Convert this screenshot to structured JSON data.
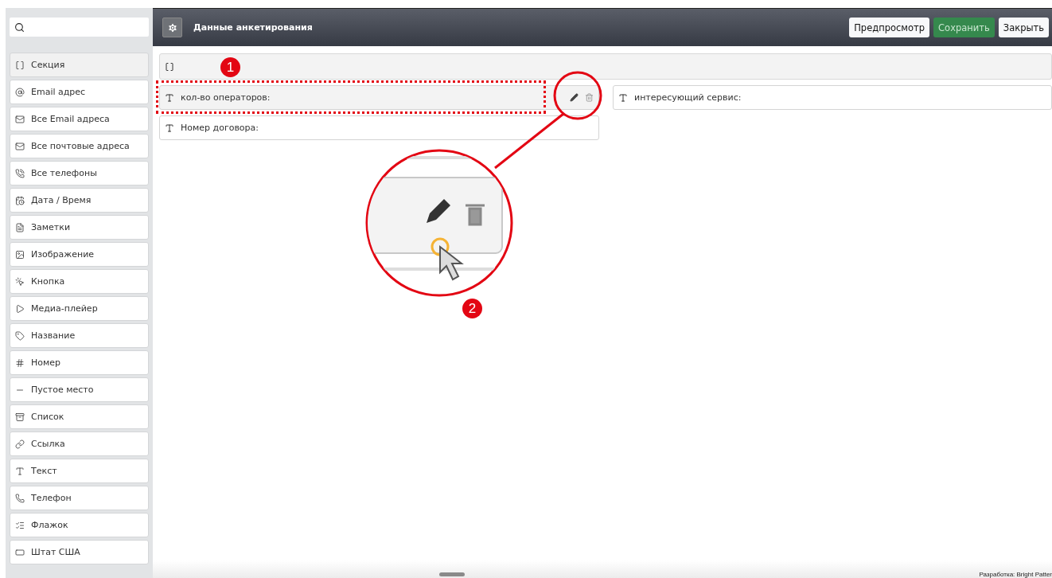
{
  "sidebar": {
    "items": [
      {
        "kind": "section",
        "label": "Секция",
        "selected": true
      },
      {
        "kind": "email",
        "label": "Email адрес",
        "selected": false
      },
      {
        "kind": "emails",
        "label": "Все Email адреса",
        "selected": false
      },
      {
        "kind": "addresses",
        "label": "Все почтовые адреса",
        "selected": false
      },
      {
        "kind": "phones",
        "label": "Все телефоны",
        "selected": false
      },
      {
        "kind": "datetime",
        "label": "Дата / Время",
        "selected": false
      },
      {
        "kind": "notes",
        "label": "Заметки",
        "selected": false
      },
      {
        "kind": "image",
        "label": "Изображение",
        "selected": false
      },
      {
        "kind": "button",
        "label": "Кнопка",
        "selected": false
      },
      {
        "kind": "media",
        "label": "Медиа-плейер",
        "selected": false
      },
      {
        "kind": "label",
        "label": "Название",
        "selected": false
      },
      {
        "kind": "number",
        "label": "Номер",
        "selected": false
      },
      {
        "kind": "spacer",
        "label": "Пустое место",
        "selected": false
      },
      {
        "kind": "list",
        "label": "Список",
        "selected": false
      },
      {
        "kind": "link",
        "label": "Ссылка",
        "selected": false
      },
      {
        "kind": "text",
        "label": "Текст",
        "selected": false
      },
      {
        "kind": "phone",
        "label": "Телефон",
        "selected": false
      },
      {
        "kind": "checkbox",
        "label": "Флажок",
        "selected": false
      },
      {
        "kind": "state",
        "label": "Штат США",
        "selected": false
      }
    ]
  },
  "header": {
    "title": "Данные анкетирования",
    "buttons": [
      {
        "label": "Предпросмотр",
        "kind": "default"
      },
      {
        "label": "Сохранить",
        "kind": "primary"
      },
      {
        "label": "Закрыть",
        "kind": "default"
      }
    ]
  },
  "form": {
    "rows": [
      [
        {
          "label": "кол-во операторов:",
          "hovered": true
        },
        {
          "label": "интересующий сервис:",
          "hovered": false
        }
      ],
      [
        {
          "label": "Номер договора:",
          "hovered": false
        }
      ]
    ]
  },
  "annotations": {
    "badges": [
      "1",
      "2"
    ]
  },
  "footer": {
    "credit": "Разработка: Bright Patter"
  }
}
